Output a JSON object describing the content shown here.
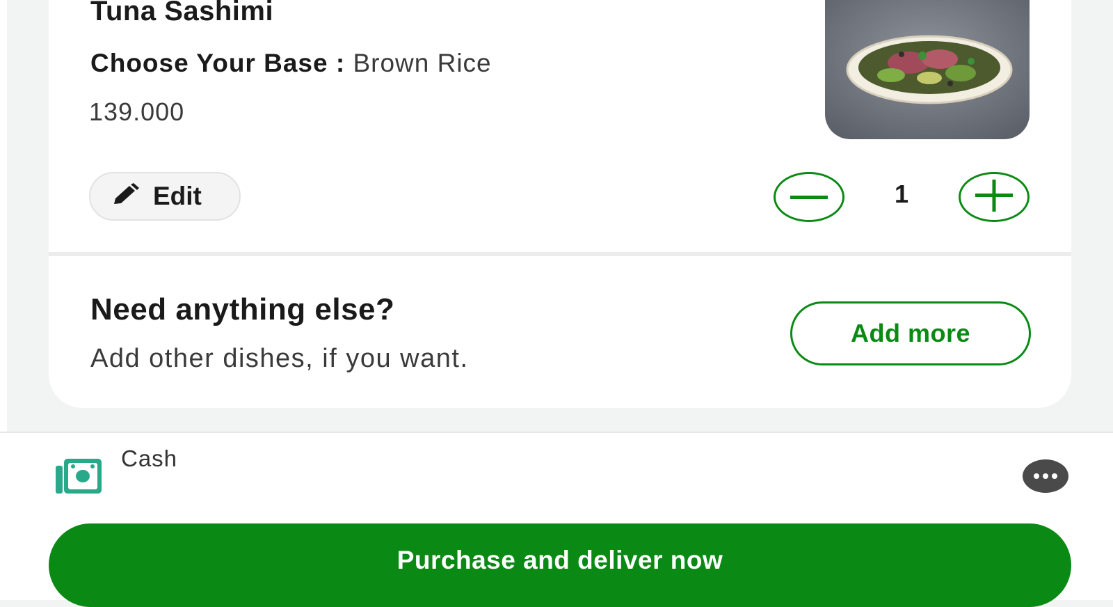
{
  "cart_item": {
    "name": "Tuna Sashimi",
    "option_key": "Choose Your Base : ",
    "option_value": "Brown Rice",
    "price": "139.000",
    "image_icon": "poke-bowl-image",
    "edit_label": "Edit",
    "quantity": "1"
  },
  "upsell": {
    "title": "Need anything else?",
    "subtitle": "Add other dishes, if you want.",
    "button_label": "Add more"
  },
  "payment": {
    "method": "Cash",
    "icon": "cash-icon"
  },
  "checkout": {
    "button_label": "Purchase and deliver now"
  },
  "colors": {
    "accent": "#0a8a14",
    "cash_icon": "#2aa88a"
  }
}
